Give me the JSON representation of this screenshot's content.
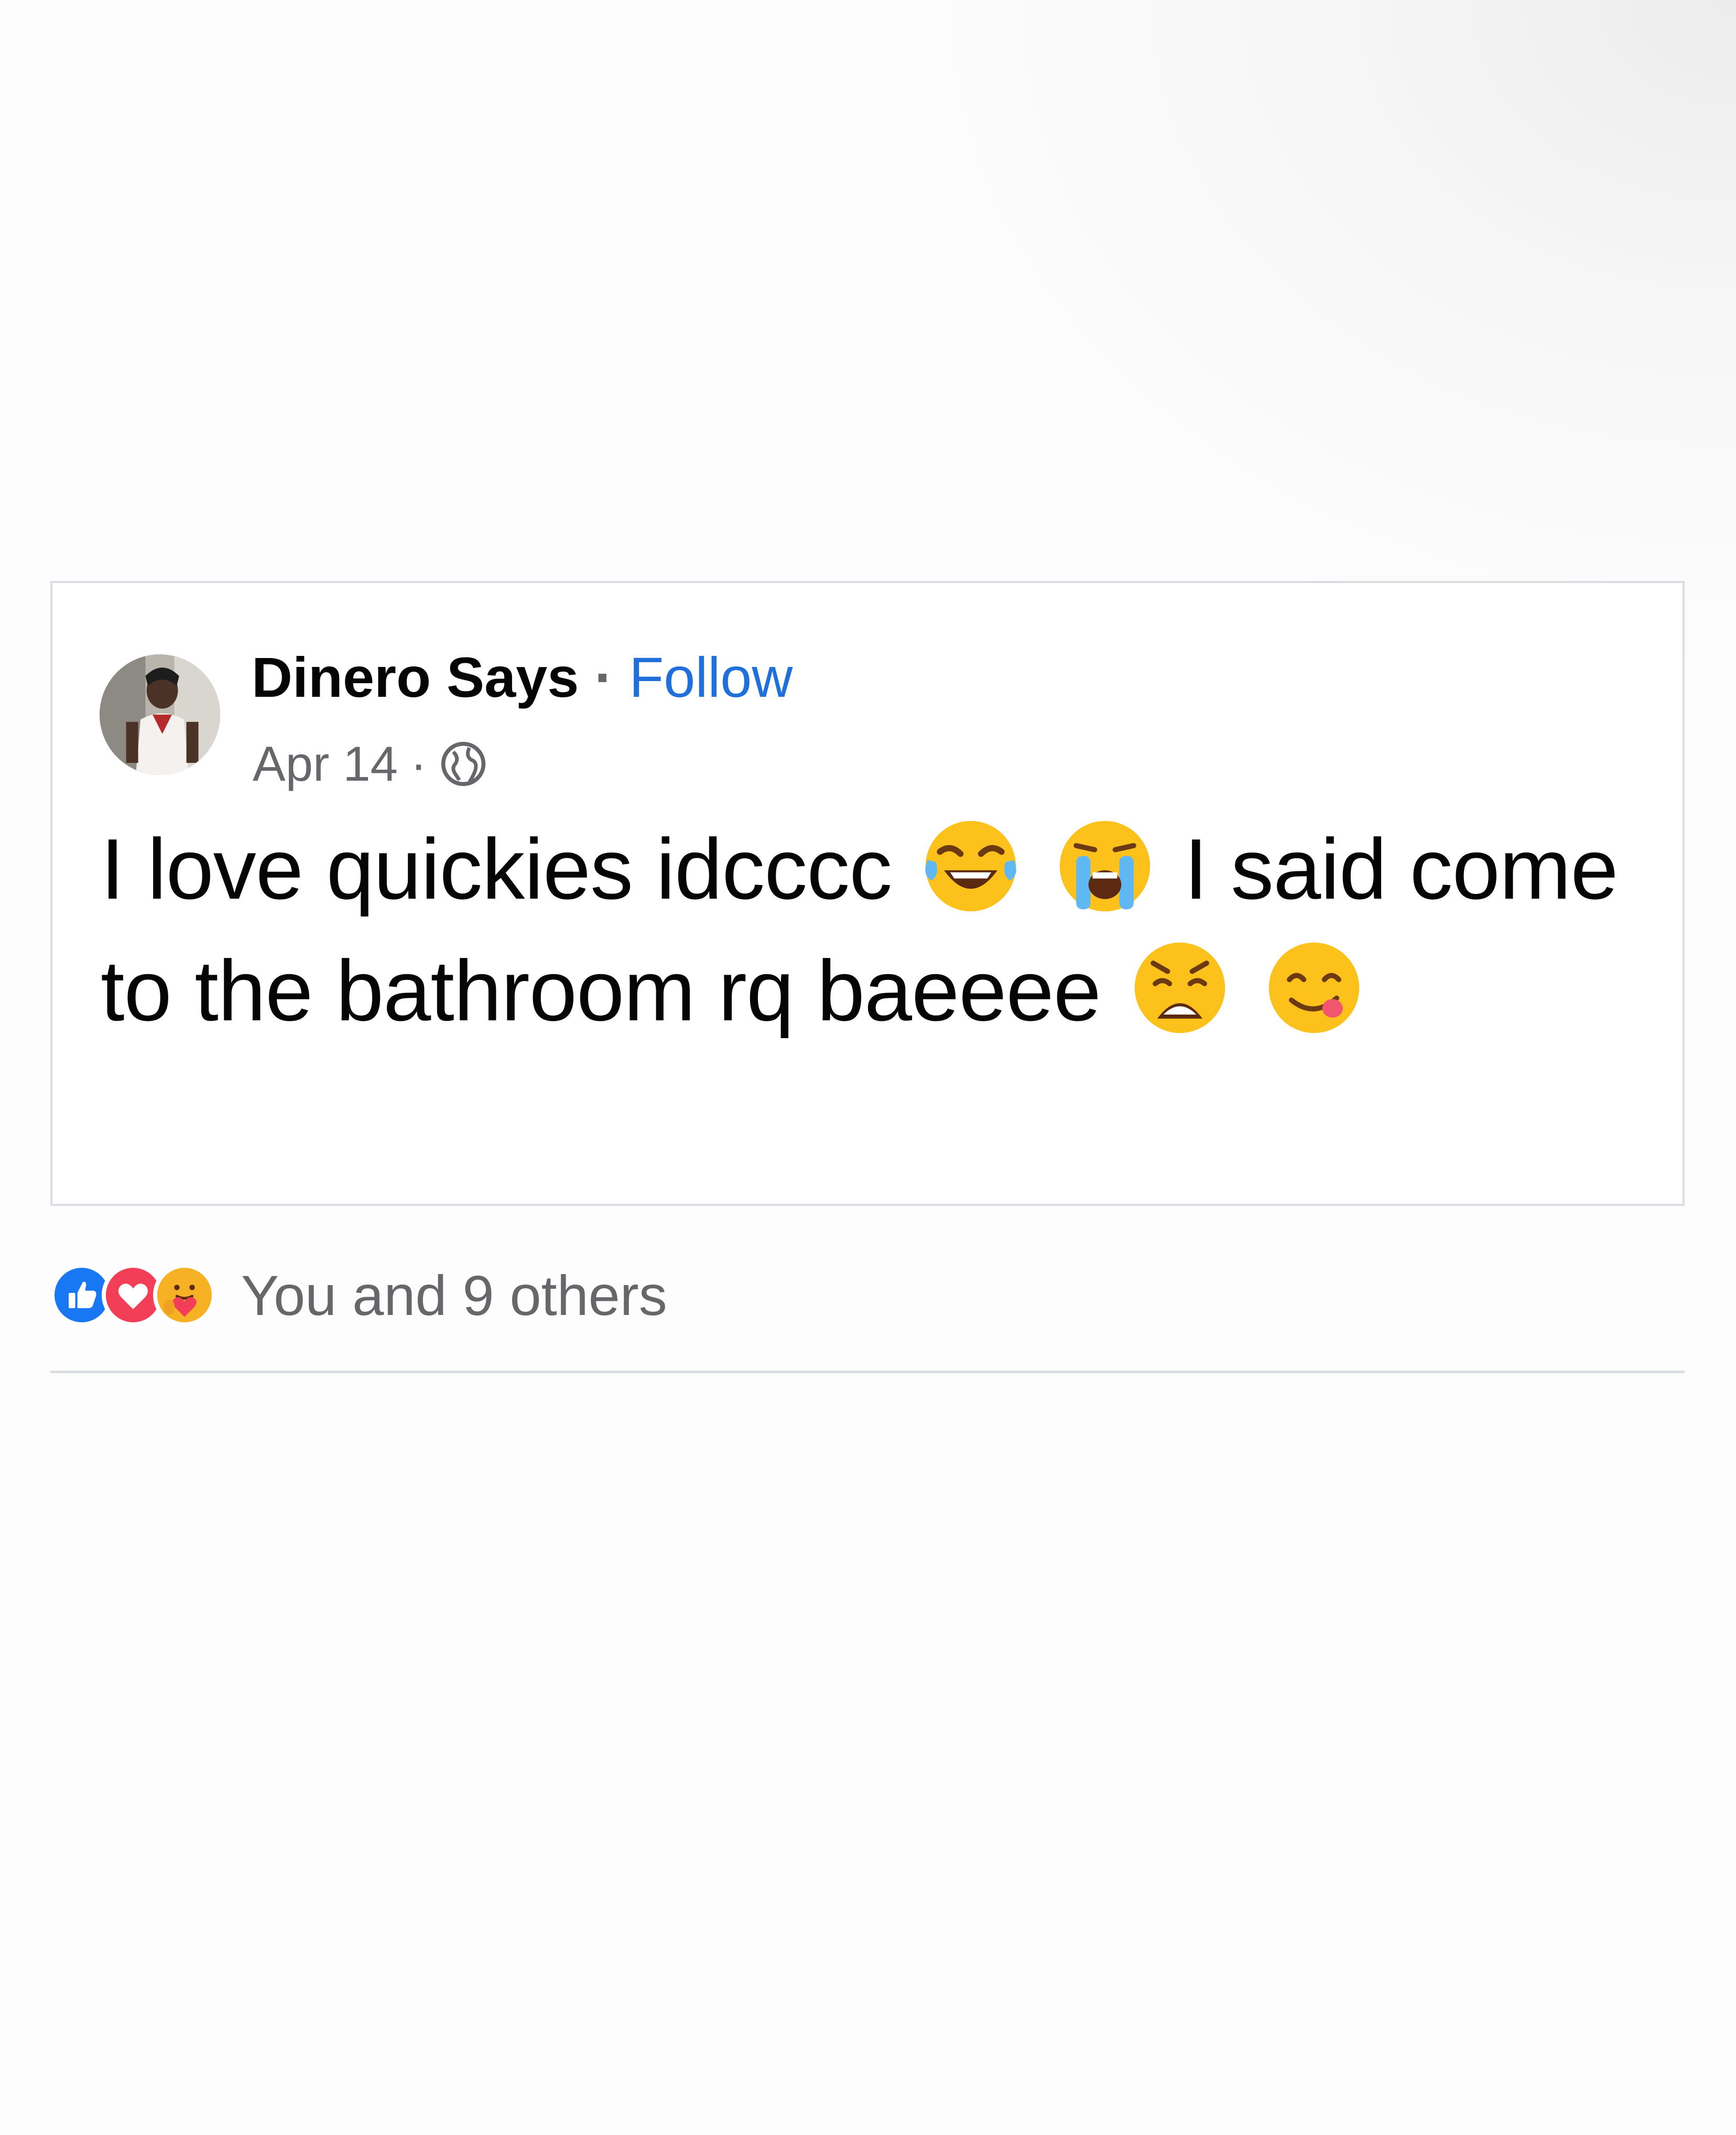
{
  "post": {
    "author": "Dinero Says",
    "separator": "·",
    "follow_label": "Follow",
    "date": "Apr 14",
    "meta_separator": "·",
    "privacy_icon": "globe-icon",
    "text_parts": [
      "I love quickies idcccc",
      "I said come to the bathroom rq baeeee"
    ],
    "emojis": [
      "face-with-tears-of-joy",
      "loudly-crying-face",
      "weary-face",
      "face-savoring-food"
    ]
  },
  "reactions": {
    "icons": [
      "like-icon",
      "love-icon",
      "care-icon"
    ],
    "summary": "You and 9 others"
  },
  "colors": {
    "link_blue": "#216fdb",
    "secondary_text": "#65676b",
    "like_blue": "#1877f2",
    "love_red": "#f33e58",
    "care_yellow": "#f7b125"
  }
}
